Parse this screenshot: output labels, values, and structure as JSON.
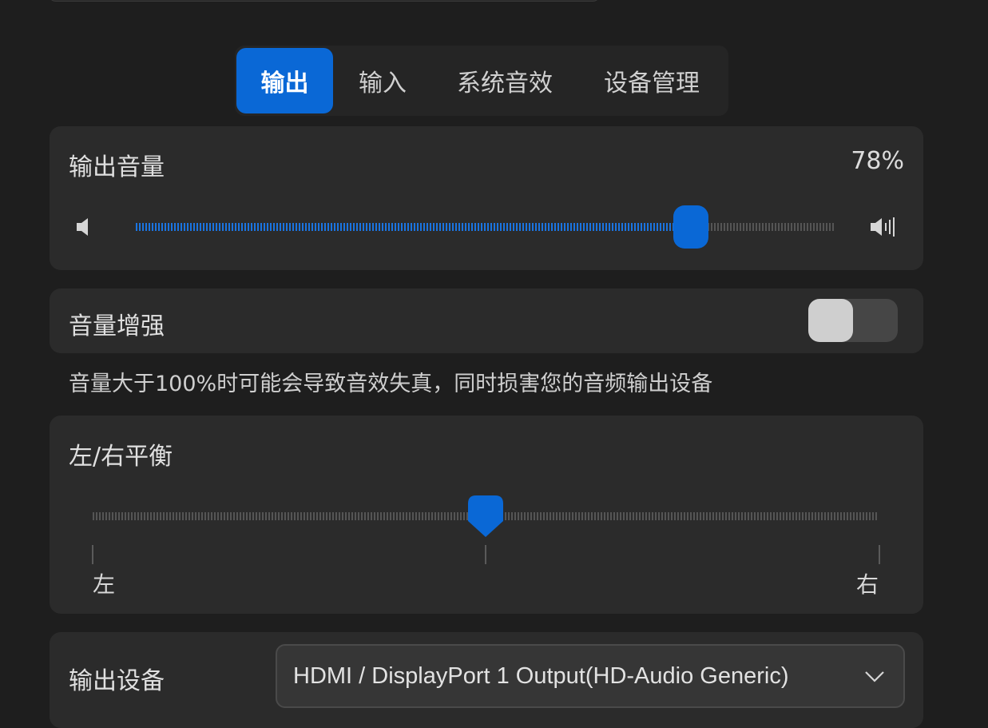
{
  "tabs": [
    {
      "label": "输出",
      "active": true
    },
    {
      "label": "输入",
      "active": false
    },
    {
      "label": "系统音效",
      "active": false
    },
    {
      "label": "设备管理",
      "active": false
    }
  ],
  "volume": {
    "title": "输出音量",
    "percent_text": "78%",
    "level": 0.78,
    "low_icon": "speaker-low-icon",
    "high_icon": "speaker-high-icon"
  },
  "boost": {
    "title": "音量增强",
    "enabled": false,
    "note": "音量大于100%时可能会导致音效失真，同时损害您的音频输出设备"
  },
  "balance": {
    "title": "左/右平衡",
    "value": 0.5,
    "left_label": "左",
    "right_label": "右"
  },
  "device": {
    "title": "输出设备",
    "selected": "HDMI / DisplayPort 1 Output(HD-Audio Generic)",
    "chevron_icon": "chevron-down-icon"
  },
  "colors": {
    "accent": "#0a68d6",
    "background": "#1e1e1e",
    "card": "#2b2b2b"
  }
}
